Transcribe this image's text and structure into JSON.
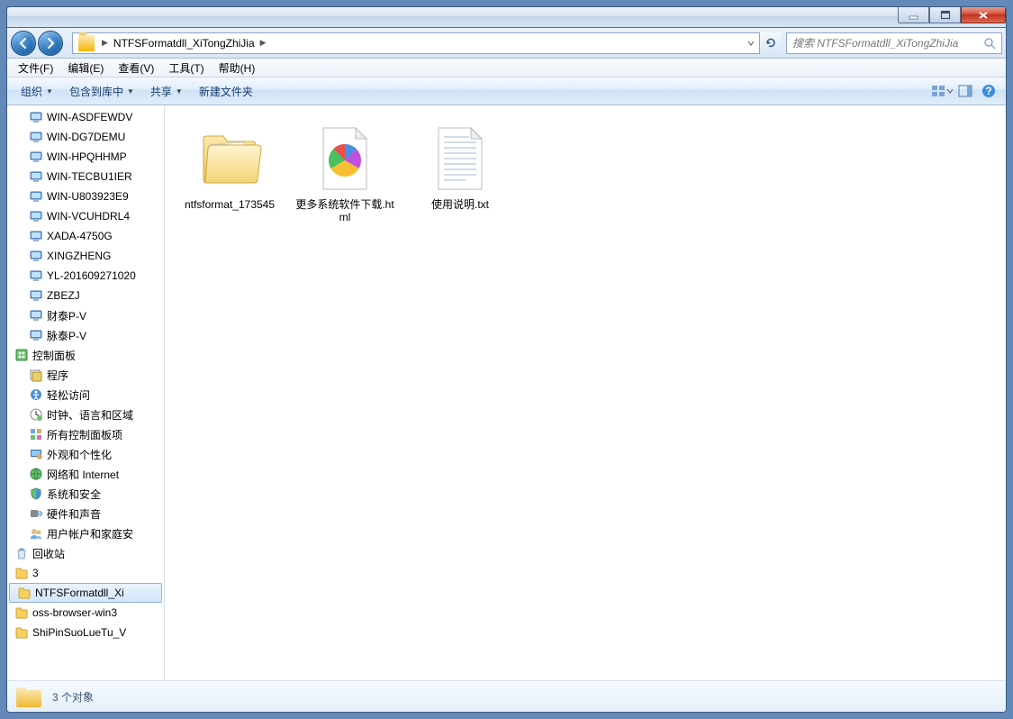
{
  "address": {
    "path": "NTFSFormatdll_XiTongZhiJia"
  },
  "search": {
    "placeholder": "搜索 NTFSFormatdll_XiTongZhiJia"
  },
  "menubar": {
    "file": "文件(F)",
    "edit": "编辑(E)",
    "view": "查看(V)",
    "tools": "工具(T)",
    "help": "帮助(H)"
  },
  "toolbar": {
    "organize": "组织",
    "include": "包含到库中",
    "share": "共享",
    "newfolder": "新建文件夹"
  },
  "tree": {
    "items": [
      {
        "icon": "computer",
        "label": "WIN-ASDFEWDV"
      },
      {
        "icon": "computer",
        "label": "WIN-DG7DEMU"
      },
      {
        "icon": "computer",
        "label": "WIN-HPQHHMP"
      },
      {
        "icon": "computer",
        "label": "WIN-TECBU1IER"
      },
      {
        "icon": "computer",
        "label": "WIN-U803923E9"
      },
      {
        "icon": "computer",
        "label": "WIN-VCUHDRL4"
      },
      {
        "icon": "computer",
        "label": "XADA-4750G"
      },
      {
        "icon": "computer",
        "label": "XINGZHENG"
      },
      {
        "icon": "computer",
        "label": "YL-201609271020"
      },
      {
        "icon": "computer",
        "label": "ZBEZJ"
      },
      {
        "icon": "computer",
        "label": "财泰P-V"
      },
      {
        "icon": "computer",
        "label": "脉泰P-V"
      }
    ],
    "cp": {
      "label": "控制面板",
      "items": [
        {
          "icon": "prog",
          "label": "程序"
        },
        {
          "icon": "access",
          "label": "轻松访问"
        },
        {
          "icon": "clock",
          "label": "时钟、语言和区域"
        },
        {
          "icon": "all",
          "label": "所有控制面板项"
        },
        {
          "icon": "appear",
          "label": "外观和个性化"
        },
        {
          "icon": "net",
          "label": "网络和 Internet"
        },
        {
          "icon": "sec",
          "label": "系统和安全"
        },
        {
          "icon": "hw",
          "label": "硬件和声音"
        },
        {
          "icon": "user",
          "label": "用户帐户和家庭安"
        }
      ]
    },
    "recycle": {
      "label": "回收站"
    },
    "folders": [
      {
        "label": "3"
      },
      {
        "label": "NTFSFormatdll_Xi",
        "selected": true
      },
      {
        "label": "oss-browser-win3"
      },
      {
        "label": "ShiPinSuoLueTu_V"
      }
    ]
  },
  "files": [
    {
      "type": "folder",
      "name": "ntfsformat_173545"
    },
    {
      "type": "html",
      "name": "更多系统软件下载.html"
    },
    {
      "type": "txt",
      "name": "使用说明.txt"
    }
  ],
  "status": {
    "text": "3 个对象"
  }
}
